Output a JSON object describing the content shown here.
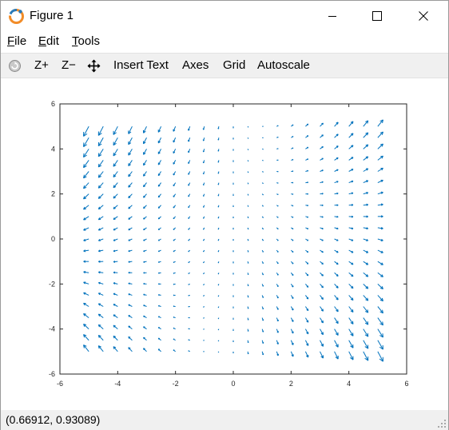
{
  "window": {
    "title": "Figure 1"
  },
  "menu": {
    "items": [
      {
        "label": "File",
        "key": "F",
        "rest": "ile"
      },
      {
        "label": "Edit",
        "key": "E",
        "rest": "dit"
      },
      {
        "label": "Tools",
        "key": "T",
        "rest": "ools"
      }
    ]
  },
  "toolbar": {
    "zoom_in_label": "Z+",
    "zoom_out_label": "Z−",
    "insert_text_label": "Insert Text",
    "axes_label": "Axes",
    "grid_label": "Grid",
    "autoscale_label": "Autoscale"
  },
  "status": {
    "coords": "(0.66912, 0.93089)"
  },
  "colors": {
    "quiver": "#0072bd",
    "toolbar_bg": "#f0f0f0"
  },
  "chart_data": {
    "type": "quiver",
    "xlim": [
      -6,
      6
    ],
    "ylim": [
      -6,
      6
    ],
    "xticks": [
      -6,
      -4,
      -2,
      0,
      2,
      4,
      6
    ],
    "yticks": [
      -6,
      -4,
      -2,
      0,
      2,
      4,
      6
    ],
    "grid": [
      -5,
      5,
      21
    ],
    "u_expr": "0.05*x",
    "v_expr": "-0.1 + 0.02*x*y",
    "series": [
      {
        "color": "#0072bd"
      }
    ],
    "legend": "none"
  }
}
